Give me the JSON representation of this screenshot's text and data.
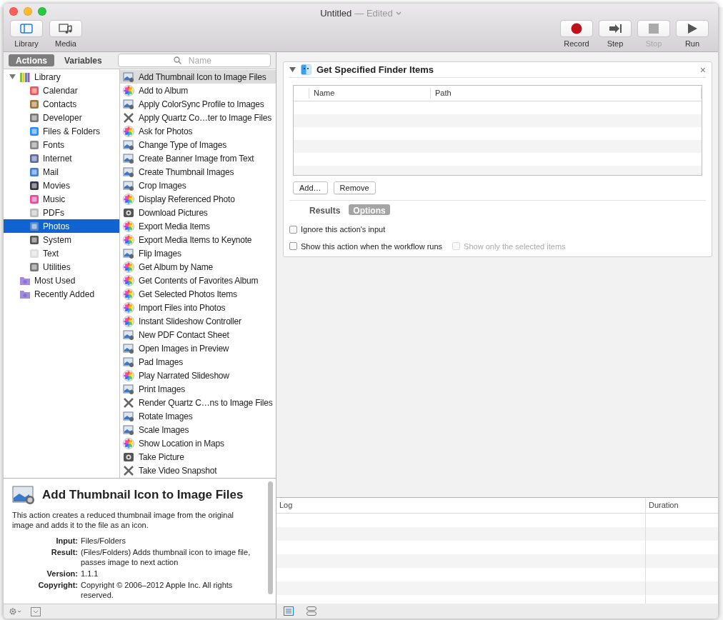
{
  "window": {
    "title": "Untitled",
    "subtitle": "— Edited"
  },
  "toolbar_left": [
    {
      "label": "Library",
      "kind": "library",
      "selected": true
    },
    {
      "label": "Media",
      "kind": "media",
      "selected": false
    }
  ],
  "toolbar_right": [
    {
      "label": "Record",
      "kind": "record",
      "disabled": false
    },
    {
      "label": "Step",
      "kind": "step",
      "disabled": false
    },
    {
      "label": "Stop",
      "kind": "stop",
      "disabled": true
    },
    {
      "label": "Run",
      "kind": "run",
      "disabled": false
    }
  ],
  "library_tabs": [
    {
      "label": "Actions",
      "selected": true
    },
    {
      "label": "Variables",
      "selected": false
    }
  ],
  "search": {
    "placeholder": "Name"
  },
  "library": [
    {
      "label": "Library",
      "kind": "library",
      "expanded": true,
      "selected": false,
      "children": [
        {
          "label": "Calendar",
          "selected": false
        },
        {
          "label": "Contacts",
          "selected": false
        },
        {
          "label": "Developer",
          "selected": false
        },
        {
          "label": "Files & Folders",
          "selected": false
        },
        {
          "label": "Fonts",
          "selected": false
        },
        {
          "label": "Internet",
          "selected": false
        },
        {
          "label": "Mail",
          "selected": false
        },
        {
          "label": "Movies",
          "selected": false
        },
        {
          "label": "Music",
          "selected": false
        },
        {
          "label": "PDFs",
          "selected": false
        },
        {
          "label": "Photos",
          "selected": true
        },
        {
          "label": "System",
          "selected": false
        },
        {
          "label": "Text",
          "selected": false
        },
        {
          "label": "Utilities",
          "selected": false
        }
      ]
    },
    {
      "label": "Most Used",
      "kind": "smart_folder",
      "selected": false
    },
    {
      "label": "Recently Added",
      "kind": "smart_folder",
      "selected": false
    }
  ],
  "actions": [
    {
      "label": "Add Thumbnail Icon to Image Files",
      "kind": "image",
      "selected": true
    },
    {
      "label": "Add to Album",
      "kind": "photos",
      "selected": false
    },
    {
      "label": "Apply ColorSync Profile to Images",
      "kind": "image",
      "selected": false
    },
    {
      "label": "Apply Quartz Co…ter to Image Files",
      "kind": "quartz",
      "selected": false
    },
    {
      "label": "Ask for Photos",
      "kind": "photos",
      "selected": false
    },
    {
      "label": "Change Type of Images",
      "kind": "image",
      "selected": false
    },
    {
      "label": "Create Banner Image from Text",
      "kind": "image",
      "selected": false
    },
    {
      "label": "Create Thumbnail Images",
      "kind": "image",
      "selected": false
    },
    {
      "label": "Crop Images",
      "kind": "image",
      "selected": false
    },
    {
      "label": "Display Referenced Photo",
      "kind": "photos",
      "selected": false
    },
    {
      "label": "Download Pictures",
      "kind": "camera",
      "selected": false
    },
    {
      "label": "Export Media Items",
      "kind": "photos",
      "selected": false
    },
    {
      "label": "Export Media Items to Keynote",
      "kind": "photos",
      "selected": false
    },
    {
      "label": "Flip Images",
      "kind": "image",
      "selected": false
    },
    {
      "label": "Get Album by Name",
      "kind": "photos",
      "selected": false
    },
    {
      "label": "Get Contents of Favorites Album",
      "kind": "photos",
      "selected": false
    },
    {
      "label": "Get Selected Photos Items",
      "kind": "photos",
      "selected": false
    },
    {
      "label": "Import Files into Photos",
      "kind": "photos",
      "selected": false
    },
    {
      "label": "Instant Slideshow Controller",
      "kind": "photos",
      "selected": false
    },
    {
      "label": "New PDF Contact Sheet",
      "kind": "image",
      "selected": false
    },
    {
      "label": "Open Images in Preview",
      "kind": "image",
      "selected": false
    },
    {
      "label": "Pad Images",
      "kind": "image",
      "selected": false
    },
    {
      "label": "Play Narrated Slideshow",
      "kind": "photos",
      "selected": false
    },
    {
      "label": "Print Images",
      "kind": "image",
      "selected": false
    },
    {
      "label": "Render Quartz C…ns to Image Files",
      "kind": "quartz",
      "selected": false
    },
    {
      "label": "Rotate Images",
      "kind": "image",
      "selected": false
    },
    {
      "label": "Scale Images",
      "kind": "image",
      "selected": false
    },
    {
      "label": "Show Location in Maps",
      "kind": "photos",
      "selected": false
    },
    {
      "label": "Take Picture",
      "kind": "camera",
      "selected": false
    },
    {
      "label": "Take Video Snapshot",
      "kind": "quartz",
      "selected": false
    }
  ],
  "description": {
    "title": "Add Thumbnail Icon to Image Files",
    "text": "This action creates a reduced thumbnail image from the original image and adds it to the file as an icon.",
    "fields": [
      {
        "label": "Input:",
        "value": "Files/Folders"
      },
      {
        "label": "Result:",
        "value": "(Files/Folders) Adds thumbnail icon to image file, passes image to next action"
      },
      {
        "label": "Version:",
        "value": "1.1.1"
      },
      {
        "label": "Copyright:",
        "value": "Copyright © 2006–2012 Apple Inc.  All rights reserved."
      }
    ]
  },
  "action_card": {
    "title": "Get Specified Finder Items",
    "expanded": true,
    "close": "×",
    "table": {
      "columns": [
        "Name",
        "Path"
      ]
    },
    "buttons": [
      "Add…",
      "Remove"
    ],
    "tabs": [
      {
        "label": "Results",
        "selected": false
      },
      {
        "label": "Options",
        "selected": true
      }
    ],
    "options": [
      {
        "label": "Ignore this action's input",
        "checked": false,
        "disabled": false
      },
      {
        "label": "Show this action when the workflow runs",
        "checked": false,
        "disabled": false
      },
      {
        "label": "Show only the selected items",
        "checked": false,
        "disabled": true
      }
    ]
  },
  "log": {
    "columns": [
      "Log",
      "Duration"
    ]
  },
  "view_buttons": [
    {
      "kind": "list",
      "selected": true
    },
    {
      "kind": "split",
      "selected": false
    }
  ]
}
